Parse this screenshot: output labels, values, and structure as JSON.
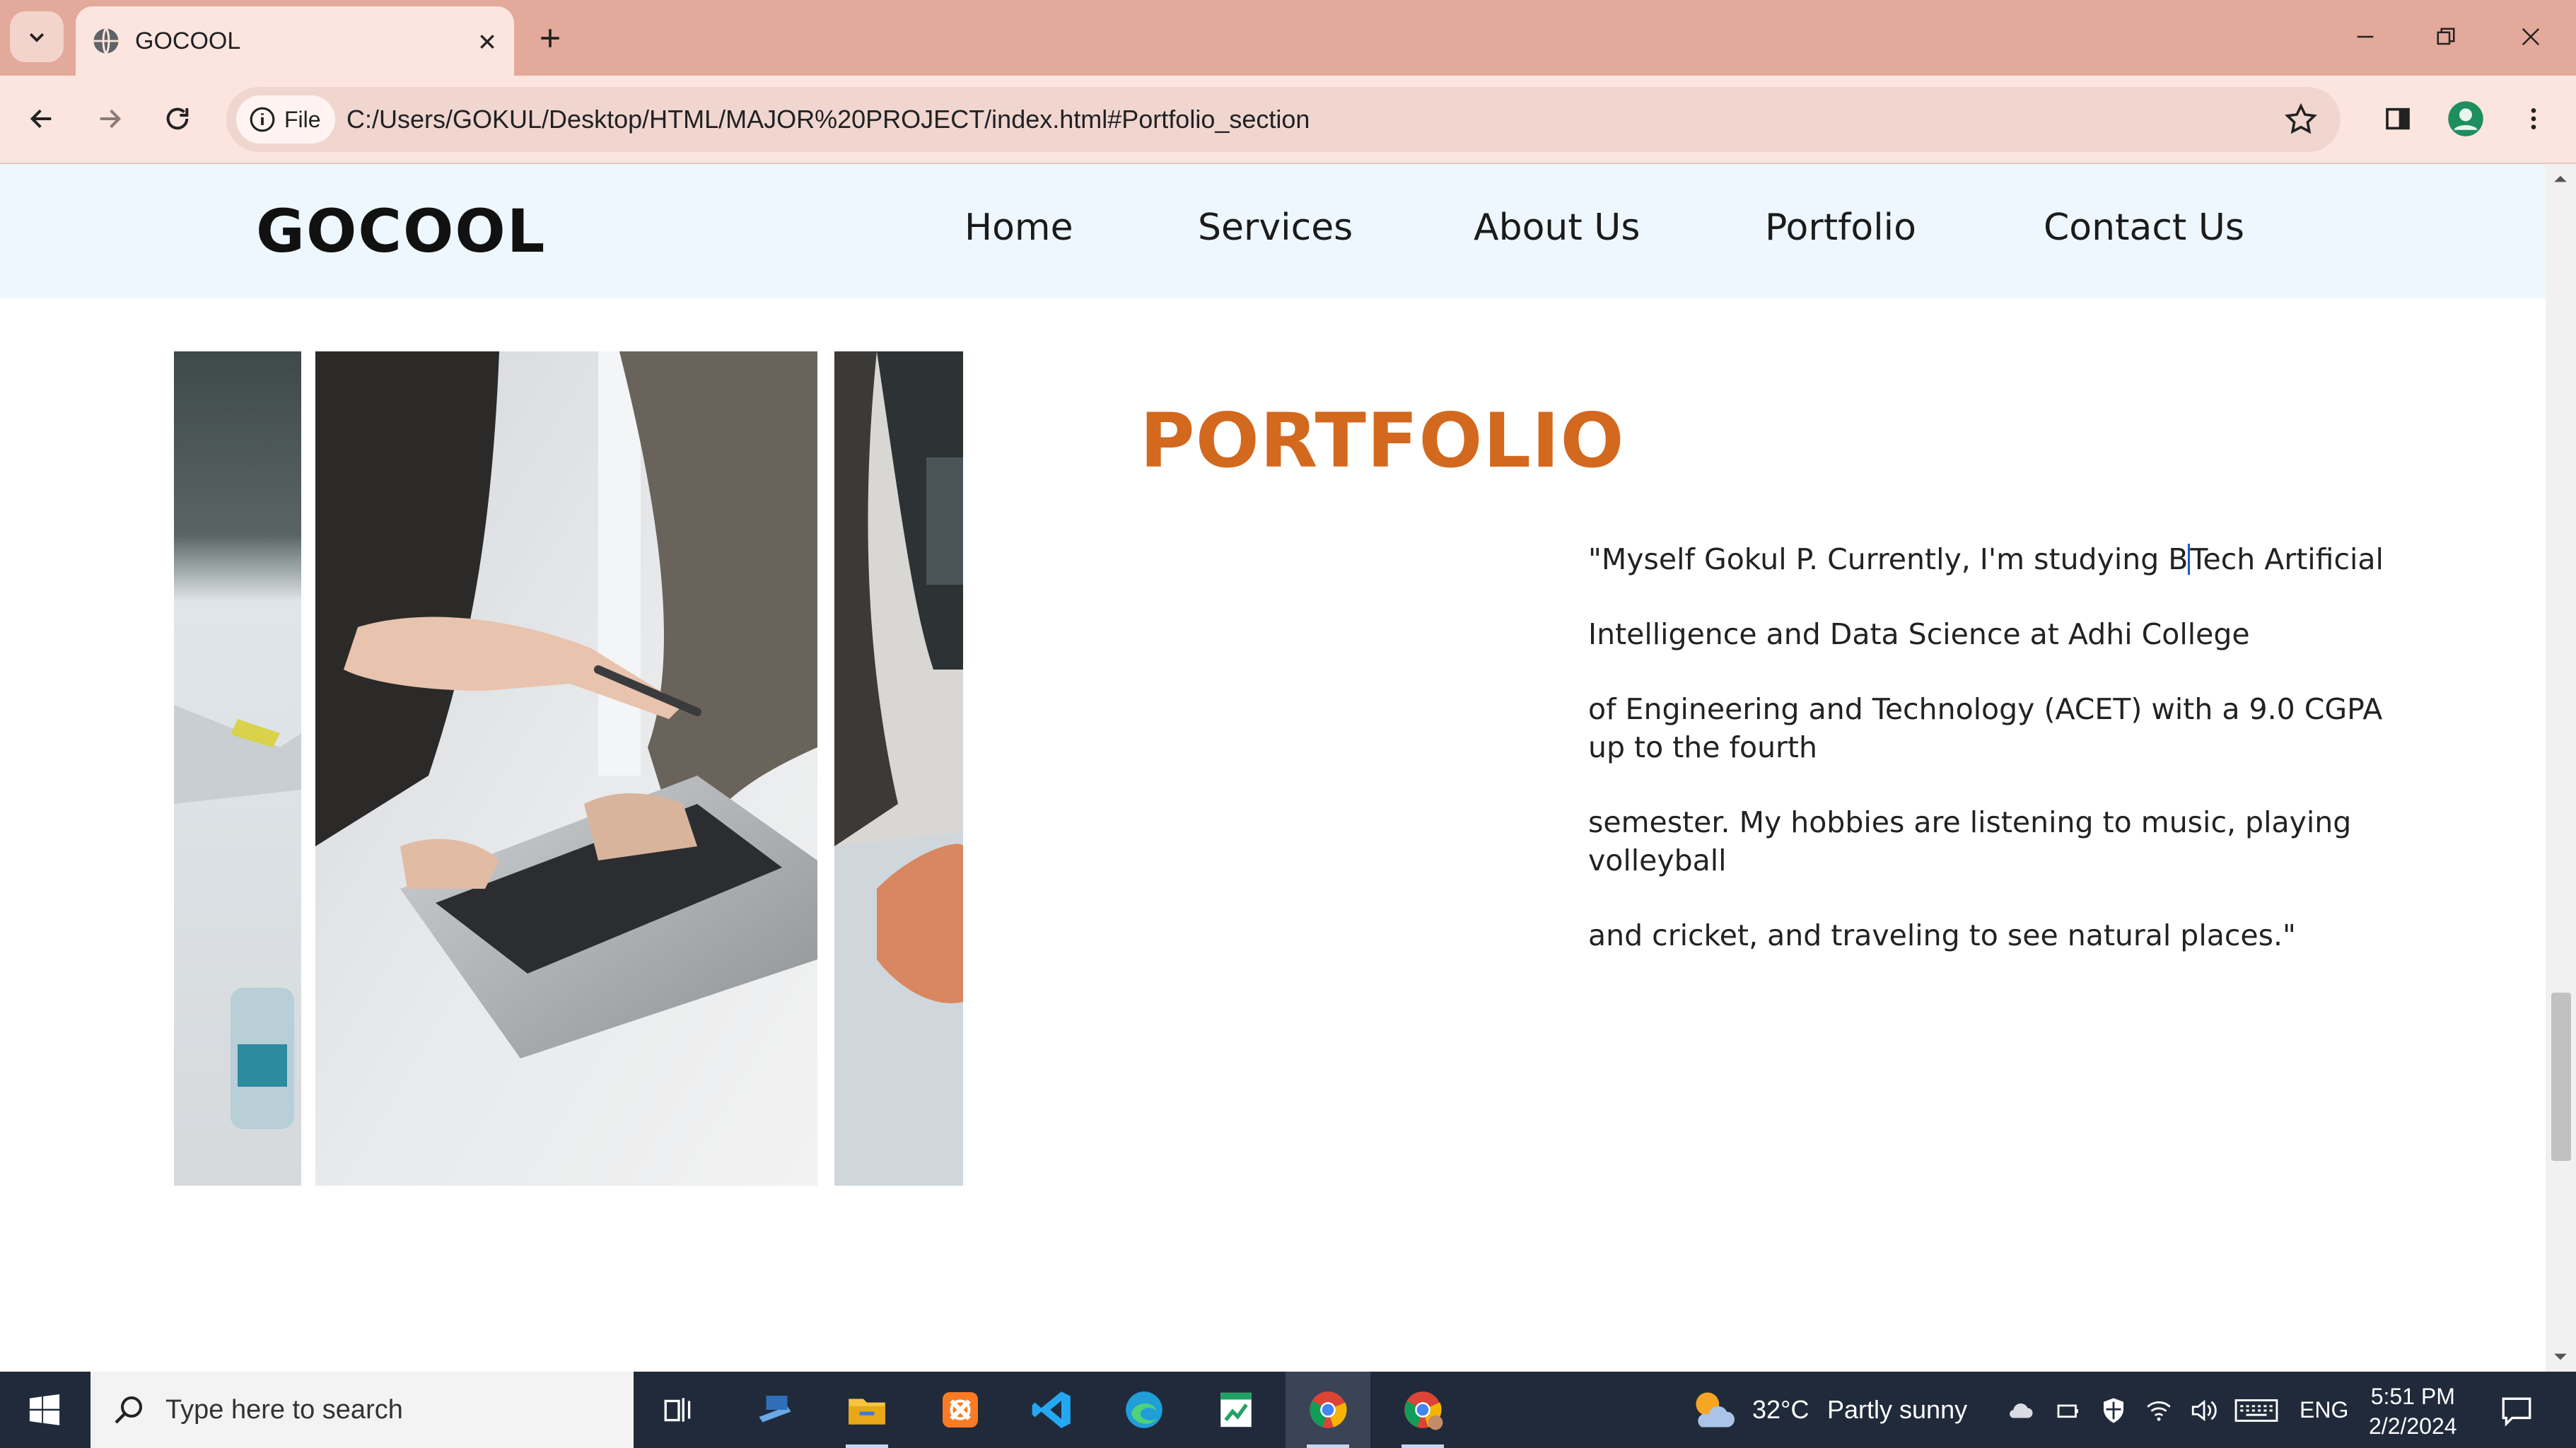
{
  "browser": {
    "tab": {
      "title": "GOCOOL"
    },
    "omnibox": {
      "chip_label": "File",
      "url": "C:/Users/GOKUL/Desktop/HTML/MAJOR%20PROJECT/index.html#Portfolio_section"
    }
  },
  "site": {
    "logo": "GOCOOL",
    "nav": [
      "Home",
      "Services",
      "About Us",
      "Portfolio",
      "Contact Us"
    ],
    "portfolio_title": "PORTFOLIO",
    "bio": {
      "p1_before_cursor": "\"Myself Gokul P. Currently, I'm studying B",
      "p1_after_cursor": "Tech Artificial",
      "p2": "Intelligence and Data Science at Adhi College",
      "p3": "of Engineering and Technology (ACET) with a 9.0 CGPA up to the fourth",
      "p4": "semester. My hobbies are listening to music, playing volleyball",
      "p5": "and cricket, and traveling to see natural places.\""
    },
    "accent_color": "#d2691e"
  },
  "taskbar": {
    "search_placeholder": "Type here to search",
    "weather": {
      "temp": "32°C",
      "condition": "Partly sunny"
    },
    "language": "ENG",
    "time": "5:51 PM",
    "date": "2/2/2024"
  }
}
